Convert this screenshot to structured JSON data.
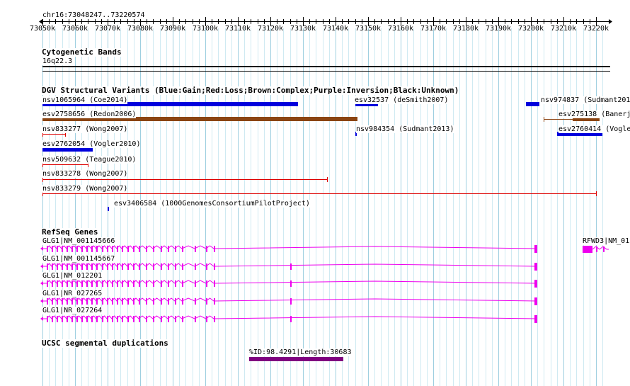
{
  "locus": "chr16:73048247..73220574",
  "ruler": {
    "ticks": [
      "73050k",
      "73060k",
      "73070k",
      "73080k",
      "73090k",
      "73100k",
      "73110k",
      "73120k",
      "73130k",
      "73140k",
      "73150k",
      "73160k",
      "73170k",
      "73180k",
      "73190k",
      "73200k",
      "73210k",
      "73220k"
    ]
  },
  "cytoband": {
    "title": "Cytogenetic Bands",
    "band": "16q22.3"
  },
  "dgv": {
    "title": "DGV Structural Variants (Blue:Gain;Red:Loss;Brown:Complex;Purple:Inversion;Black:Unknown)",
    "colors": {
      "gain": "#0000dd",
      "loss": "#dd0000",
      "complex": "#8b4513"
    },
    "features": [
      {
        "label": "nsv1065964 (Coe2014)",
        "type": "gain",
        "start_kb": 73050.0,
        "end_kb": 73128.5
      },
      {
        "label": "esv32537 (deSmith2007)",
        "type": "gain",
        "start_kb": 73146.0,
        "end_kb": 73153.0
      },
      {
        "label": "nsv974837 (Sudmant201",
        "type": "gain",
        "start_kb": 73198.5,
        "end_kb": 73202.5
      },
      {
        "label": "esv2758656 (Redon2006)",
        "type": "complex",
        "start_kb": 73050.0,
        "end_kb": 73146.8
      },
      {
        "label": "esv275138 (Banerj",
        "type": "complex",
        "start_kb": 73204.0,
        "end_kb": 73221.0
      },
      {
        "label": "nsv833277 (Wong2007)",
        "type": "loss",
        "start_kb": 73050.0,
        "end_kb": 73057.0
      },
      {
        "label": "nsv984354 (Sudmant2013)",
        "type": "gain",
        "start_kb": 73146.0,
        "end_kb": 73146.5
      },
      {
        "label": "esv2760414 (Vogle",
        "type": "gain",
        "start_kb": 73208.0,
        "end_kb": 73222.0
      },
      {
        "label": "esv2762054 (Vogler2010)",
        "type": "gain",
        "start_kb": 73050.0,
        "end_kb": 73065.5
      },
      {
        "label": "nsv509632 (Teague2010)",
        "type": "loss",
        "start_kb": 73050.0,
        "end_kb": 73064.0
      },
      {
        "label": "nsv833278 (Wong2007)",
        "type": "loss",
        "start_kb": 73050.0,
        "end_kb": 73137.5
      },
      {
        "label": "nsv833279 (Wong2007)",
        "type": "loss",
        "start_kb": 73050.0,
        "end_kb": 73220.0
      },
      {
        "label": "esv3406584 (1000GenomesConsortiumPilotProject)",
        "type": "gain",
        "start_kb": 73070.0,
        "end_kb": 73070.5
      }
    ]
  },
  "refseq": {
    "title": "RefSeq Genes",
    "color": "#ee00ee",
    "genes": [
      {
        "label": "GLG1|NM_001145666",
        "start_kb": 73050.0,
        "end_kb": 73190.0
      },
      {
        "label": "GLG1|NM_001145667",
        "start_kb": 73050.0,
        "end_kb": 73190.0
      },
      {
        "label": "GLG1|NM_012201",
        "start_kb": 73050.0,
        "end_kb": 73190.0
      },
      {
        "label": "GLG1|NR_027265",
        "start_kb": 73050.0,
        "end_kb": 73190.0
      },
      {
        "label": "GLG1|NR_027264",
        "start_kb": 73050.0,
        "end_kb": 73190.0
      },
      {
        "label": "RFWD3|NM_01",
        "start_kb": 73203.0,
        "end_kb": 73208.0
      }
    ]
  },
  "segdup": {
    "title": "UCSC segmental duplications",
    "color": "#800080",
    "features": [
      {
        "label": "%ID:98.4291|Length:30683",
        "start_kb": 73113.5,
        "end_kb": 73142.5
      }
    ]
  }
}
